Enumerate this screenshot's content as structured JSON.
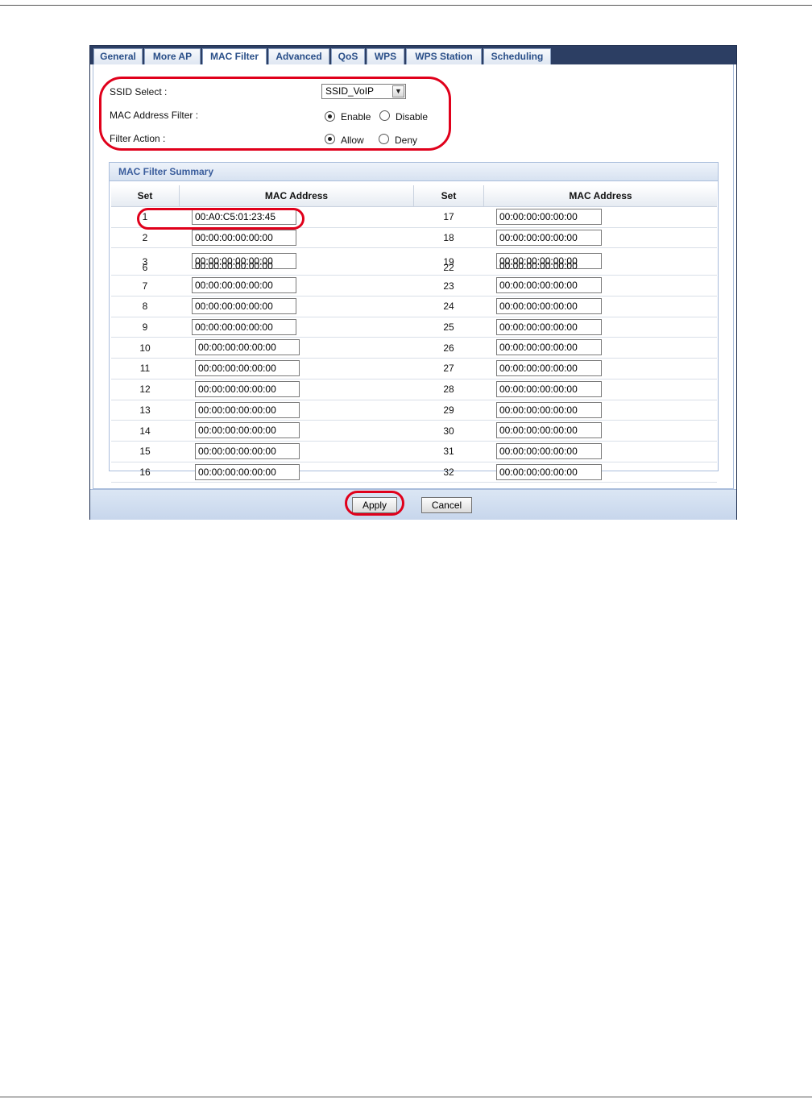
{
  "tabs": [
    "General",
    "More AP",
    "MAC Filter",
    "Advanced",
    "QoS",
    "WPS",
    "WPS Station",
    "Scheduling"
  ],
  "active_tab": "MAC Filter",
  "ssid_select": {
    "label": "SSID Select :",
    "value": "SSID_VoIP"
  },
  "mac_address_filter": {
    "label": "MAC Address Filter :",
    "enable": "Enable",
    "disable": "Disable",
    "selected": "Enable"
  },
  "filter_action": {
    "label": "Filter Action :",
    "allow": "Allow",
    "deny": "Deny",
    "selected": "Allow"
  },
  "summary": {
    "title": "MAC Filter Summary",
    "col_set": "Set",
    "col_mac": "MAC Address",
    "rows": [
      {
        "l_set": "1",
        "l_mac": "00:A0:C5:01:23:45",
        "r_set": "17",
        "r_mac": "00:00:00:00:00:00"
      },
      {
        "l_set": "2",
        "l_mac": "00:00:00:00:00:00",
        "r_set": "18",
        "r_mac": "00:00:00:00:00:00"
      },
      {
        "l_set": "3",
        "l_mac": "00:00:00:00:00:00",
        "r_set": "19",
        "r_mac": "00:00:00:00:00:00"
      },
      {
        "l_set": "7",
        "l_mac": "00:00:00:00:00:00",
        "r_set": "23",
        "r_mac": "00:00:00:00:00:00"
      },
      {
        "l_set": "8",
        "l_mac": "00:00:00:00:00:00",
        "r_set": "24",
        "r_mac": "00:00:00:00:00:00"
      },
      {
        "l_set": "9",
        "l_mac": "00:00:00:00:00:00",
        "r_set": "25",
        "r_mac": "00:00:00:00:00:00"
      },
      {
        "l_set": "10",
        "l_mac": "00:00:00:00:00:00",
        "r_set": "26",
        "r_mac": "00:00:00:00:00:00"
      },
      {
        "l_set": "11",
        "l_mac": "00:00:00:00:00:00",
        "r_set": "27",
        "r_mac": "00:00:00:00:00:00"
      },
      {
        "l_set": "12",
        "l_mac": "00:00:00:00:00:00",
        "r_set": "28",
        "r_mac": "00:00:00:00:00:00"
      },
      {
        "l_set": "13",
        "l_mac": "00:00:00:00:00:00",
        "r_set": "29",
        "r_mac": "00:00:00:00:00:00"
      },
      {
        "l_set": "14",
        "l_mac": "00:00:00:00:00:00",
        "r_set": "30",
        "r_mac": "00:00:00:00:00:00"
      },
      {
        "l_set": "15",
        "l_mac": "00:00:00:00:00:00",
        "r_set": "31",
        "r_mac": "00:00:00:00:00:00"
      },
      {
        "l_set": "16",
        "l_mac": "00:00:00:00:00:00",
        "r_set": "32",
        "r_mac": "00:00:00:00:00:00"
      }
    ],
    "overlap_row": {
      "l_set": "6",
      "l_mac": "00:00:00:00:00:00",
      "r_set": "22",
      "r_mac": "00:00:00:00:00:00"
    }
  },
  "buttons": {
    "apply": "Apply",
    "cancel": "Cancel"
  },
  "highlight_color": "#e0001b"
}
